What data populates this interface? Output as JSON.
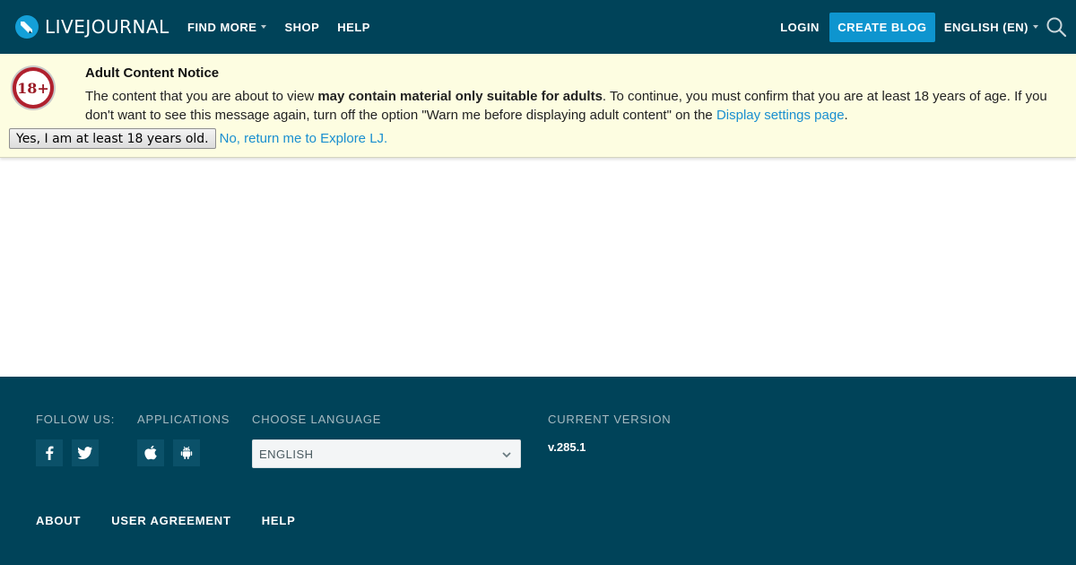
{
  "header": {
    "logo_text": "LIVEJOURNAL",
    "nav": {
      "find_more": "FIND MORE",
      "shop": "SHOP",
      "help": "HELP"
    },
    "login": "LOGIN",
    "create_blog": "CREATE BLOG",
    "language": "ENGLISH (EN)"
  },
  "notice": {
    "badge": "18+",
    "title": "Adult Content Notice",
    "text_before": "The content that you are about to view ",
    "text_bold": "may contain material only suitable for adults",
    "text_after": ". To continue, you must confirm that you are at least 18 years of age. If you don't want to see this message again, turn off the option \"Warn me before displaying adult content\" on the ",
    "settings_link": "Display settings page",
    "period": ".",
    "confirm_button": "Yes, I am at least 18 years old.",
    "decline_link": "No, return me to Explore LJ."
  },
  "footer": {
    "follow_us": "FOLLOW US:",
    "applications": "APPLICATIONS",
    "choose_language": "CHOOSE LANGUAGE",
    "language_selected": "ENGLISH",
    "current_version_label": "CURRENT VERSION",
    "version": "v.285.1",
    "links": {
      "about": "ABOUT",
      "user_agreement": "USER AGREEMENT",
      "help": "HELP"
    }
  },
  "icons": {
    "logo": "livejournal-pencil-logo",
    "search": "search-icon",
    "badge": "adult-18-badge",
    "facebook": "facebook-icon",
    "twitter": "twitter-icon",
    "apple": "apple-icon",
    "android": "android-icon",
    "chevron": "chevron-down-icon"
  },
  "colors": {
    "header_bg": "#004359",
    "accent": "#0e95cf",
    "notice_bg": "#fdfde1",
    "link": "#1a8fd0",
    "badge_red": "#b0202e"
  }
}
